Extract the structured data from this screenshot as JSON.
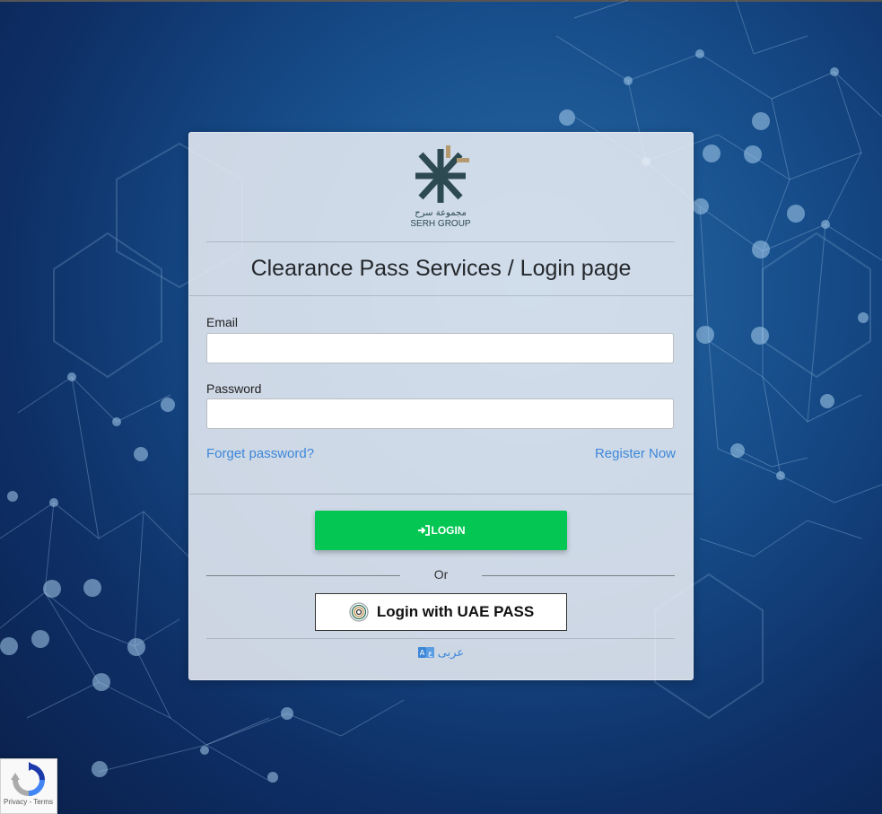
{
  "brand": {
    "logo_arabic": "مجموعة سرح",
    "logo_english": "SERH GROUP"
  },
  "page_title": "Clearance Pass Services / Login page",
  "form": {
    "email_label": "Email",
    "email_value": "",
    "password_label": "Password",
    "password_value": "",
    "forgot_link": "Forget password?",
    "register_link": "Register Now"
  },
  "actions": {
    "login_label": "LOGIN",
    "or_text": "Or",
    "uae_pass_label": "Login with UAE PASS",
    "language_label": "عربى"
  },
  "recaptcha": {
    "privacy_label": "Privacy",
    "separator": " - ",
    "terms_label": "Terms"
  },
  "colors": {
    "login_button": "#03c653",
    "link": "#3d87d9",
    "logo_dark": "#2d4a52",
    "logo_gold": "#b49a6e"
  },
  "icons": {
    "login": "sign-in-arrow-icon",
    "uae_pass": "fingerprint-icon",
    "language": "translate-icon",
    "recaptcha": "recaptcha-icon"
  }
}
